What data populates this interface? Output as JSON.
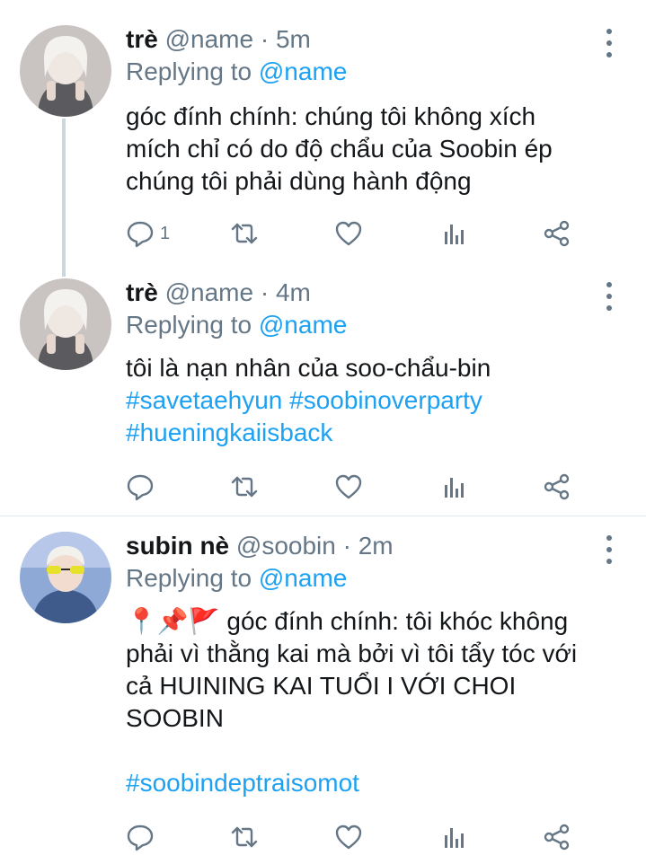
{
  "tweets": [
    {
      "name": "trè",
      "handle": "@name",
      "separator": "·",
      "time": "5m",
      "replying_prefix": "Replying to",
      "replying_to": "@name",
      "body_lines": [
        "góc đính chính: chúng tôi không xích",
        "mích chỉ có do độ chẩu của Soobin ép",
        "chúng tôi phải dùng hành động"
      ],
      "reply_count": "1"
    },
    {
      "name": "trè",
      "handle": "@name",
      "separator": "·",
      "time": "4m",
      "replying_prefix": "Replying to",
      "replying_to": "@name",
      "body_lines": [
        "tôi là nạn nhân của soo-chẩu-bin"
      ],
      "hashtag_lines": [
        "#savetaehyun #soobinoverparty",
        "#hueningkaiisback"
      ],
      "reply_count": ""
    },
    {
      "name": "subin nè",
      "handle": "@soobin",
      "separator": "·",
      "time": "2m",
      "replying_prefix": "Replying to",
      "replying_to": "@name",
      "emoji_prefix": "📍📌🚩",
      "body_lines": [
        " góc đính chính: tôi khóc không",
        "phải vì thằng kai mà bởi vì tôi tẩy tóc với",
        "cả HUINING KAI TUỔI I VỚI CHOI",
        "SOOBIN"
      ],
      "hashtag_lines": [
        "#soobindeptraisomot"
      ],
      "reply_count": ""
    }
  ],
  "icons": [
    "reply-icon",
    "retweet-icon",
    "like-icon",
    "analytics-icon",
    "share-icon",
    "more-icon"
  ],
  "colors": {
    "link": "#1da1f2",
    "muted": "#657786",
    "text": "#14171a",
    "thread_line": "#ccd6dd"
  }
}
